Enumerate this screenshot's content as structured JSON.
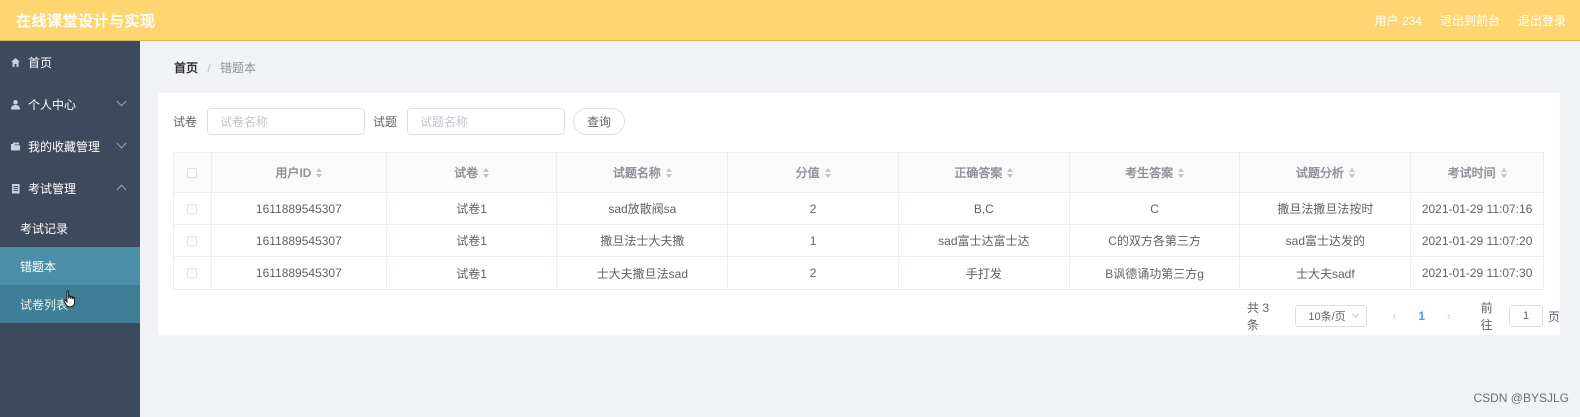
{
  "header": {
    "title": "在线课堂设计与实现",
    "user_label": "用户 234",
    "front_link": "退出到前台",
    "logout_link": "退出登录"
  },
  "sidebar": {
    "items": [
      {
        "label": "首页",
        "icon": "home-icon"
      },
      {
        "label": "个人中心",
        "icon": "user-icon"
      },
      {
        "label": "我的收藏管理",
        "icon": "folder-icon"
      },
      {
        "label": "考试管理",
        "icon": "document-icon"
      }
    ],
    "sub_items": [
      {
        "label": "考试记录"
      },
      {
        "label": "错题本"
      },
      {
        "label": "试卷列表"
      }
    ]
  },
  "breadcrumb": {
    "home": "首页",
    "separator": "/",
    "current": "错题本"
  },
  "search": {
    "paper_label": "试卷",
    "paper_placeholder": "试卷名称",
    "question_label": "试题",
    "question_placeholder": "试题名称",
    "query_button": "查询"
  },
  "table": {
    "headers": [
      "用户ID",
      "试卷",
      "试题名称",
      "分值",
      "正确答案",
      "考生答案",
      "试题分析",
      "考试时间"
    ],
    "rows": [
      [
        "1611889545307",
        "试卷1",
        "sad放散阀sa",
        "2",
        "B,C",
        "C",
        "撒旦法撒旦法按时",
        "2021-01-29 11:07:16"
      ],
      [
        "1611889545307",
        "试卷1",
        "撒旦法士大夫撒",
        "1",
        "sad富士达富士达",
        "C的双方各第三方",
        "sad富士达发的",
        "2021-01-29 11:07:20"
      ],
      [
        "1611889545307",
        "试卷1",
        "士大夫撒旦法sad",
        "2",
        "手打发",
        "B讽德诵功第三方g",
        "士大夫sadf",
        "2021-01-29 11:07:30"
      ]
    ]
  },
  "pagination": {
    "total": "共 3 条",
    "page_size": "10条/页",
    "prev": "‹",
    "current_page": "1",
    "next": "›",
    "goto_label": "前往",
    "goto_value": "1",
    "page_suffix": "页"
  },
  "watermark": "CSDN @BYSJLG",
  "colors": {
    "header_bg": "#fdd571",
    "sidebar_bg": "#3d4a5c",
    "active_item_bg": "#4b90a8",
    "link_blue": "#409eff"
  }
}
